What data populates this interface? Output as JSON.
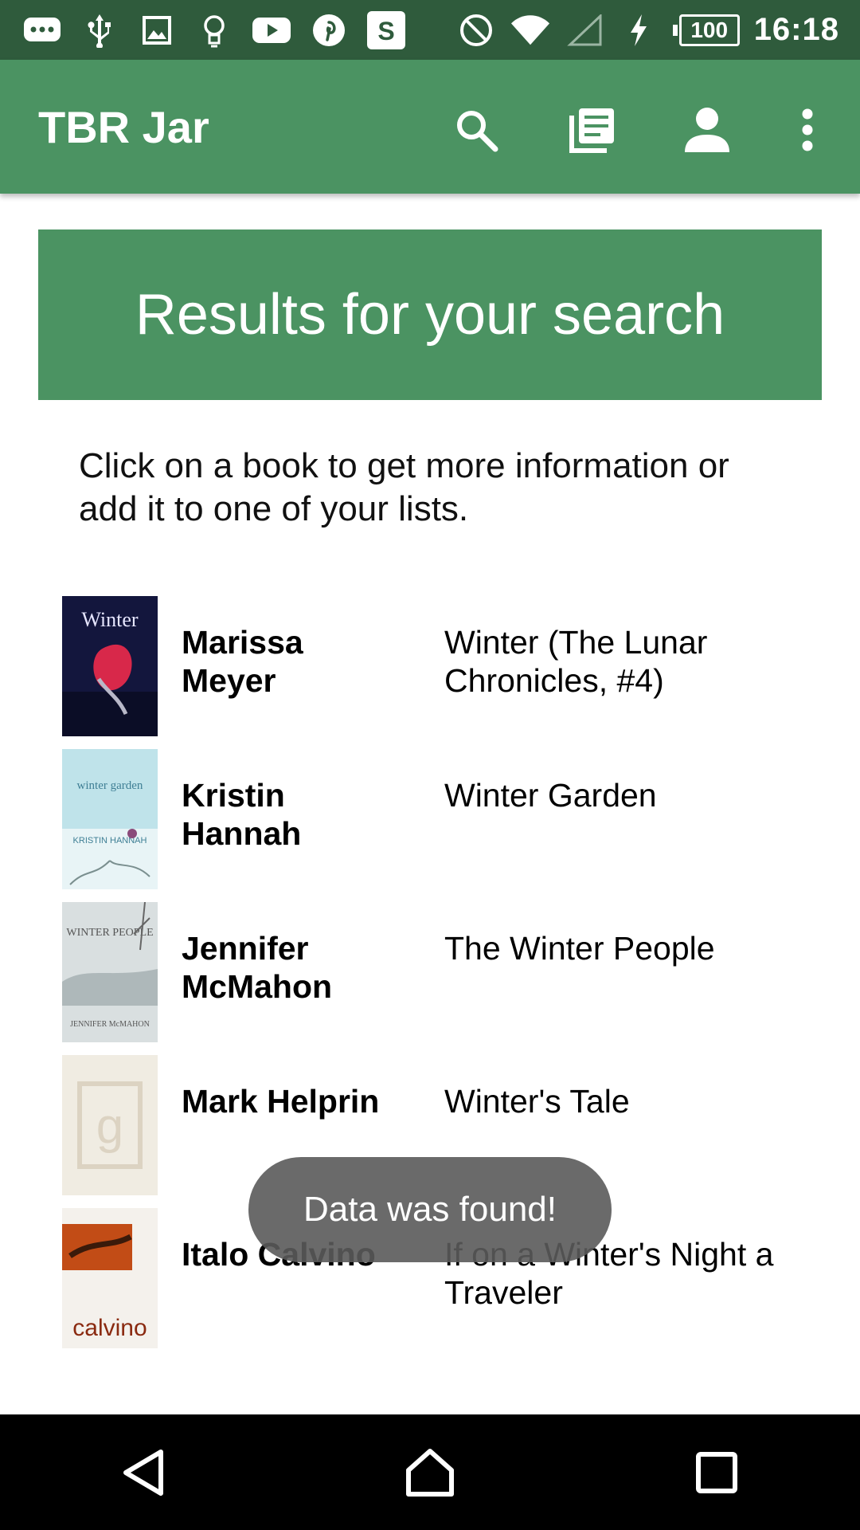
{
  "status_bar": {
    "icons": [
      "messenger-icon",
      "usb-icon",
      "image-icon",
      "lightbulb-icon",
      "youtube-icon",
      "pinterest-icon",
      "s-app-icon"
    ],
    "s_app_letter": "S",
    "battery_level": "100",
    "time": "16:18"
  },
  "app_bar": {
    "title": "TBR Jar",
    "actions": [
      "search-icon",
      "list-icon",
      "account-icon",
      "more-options-icon"
    ]
  },
  "banner": {
    "text": "Results for your search"
  },
  "intro": {
    "text": "Click on a book to get more information or add it to one of your lists."
  },
  "books": [
    {
      "author": "Marissa Meyer",
      "title": "Winter (The Lunar Chronicles, #4)",
      "cover_text": "Winter"
    },
    {
      "author": "Kristin Hannah",
      "title": "Winter Garden",
      "cover_text": "winter garden",
      "cover_author": "KRISTIN HANNAH"
    },
    {
      "author": "Jennifer McMahon",
      "title": "The Winter People",
      "cover_text": "WINTER PEOPLE",
      "cover_author": "JENNIFER McMAHON"
    },
    {
      "author": "Mark Helprin",
      "title": "Winter's Tale",
      "cover_text": "g"
    },
    {
      "author": "Italo Calvino",
      "title": "If on a Winter's Night a Traveler",
      "cover_text": "calvino"
    }
  ],
  "toast": {
    "text": "Data was found!"
  },
  "colors": {
    "primary": "#4b9362",
    "status_bar": "#2f5b3c",
    "toast": "#5a5a5a"
  },
  "nav_bar": {
    "buttons": [
      "back-icon",
      "home-icon",
      "recents-icon"
    ]
  }
}
